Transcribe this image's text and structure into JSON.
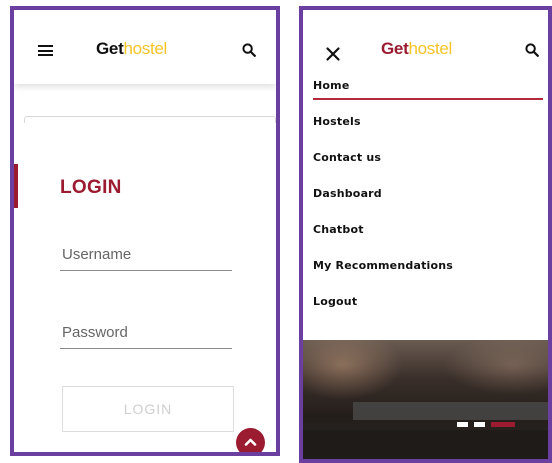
{
  "brand": {
    "part1": "Get",
    "part2": "hostel",
    "accent_color": "#f6c428",
    "primary_color": "#9b1b30"
  },
  "left_screen": {
    "login_title": "LOGIN",
    "username": {
      "placeholder": "Username",
      "value": ""
    },
    "password": {
      "placeholder": "Password",
      "value": ""
    },
    "login_button": "LOGIN",
    "icons": [
      "hamburger-icon",
      "search-icon",
      "chevron-up-icon"
    ]
  },
  "right_screen": {
    "menu": [
      {
        "label": "Home",
        "active": true
      },
      {
        "label": "Hostels"
      },
      {
        "label": "Contact us"
      },
      {
        "label": "Dashboard"
      },
      {
        "label": "Chatbot"
      },
      {
        "label": "My Recommendations"
      },
      {
        "label": "Logout"
      }
    ],
    "carousel": {
      "slides": 3,
      "active_index": 2
    },
    "icons": [
      "close-icon",
      "search-icon"
    ]
  },
  "frame_color": "#6a3fa0"
}
